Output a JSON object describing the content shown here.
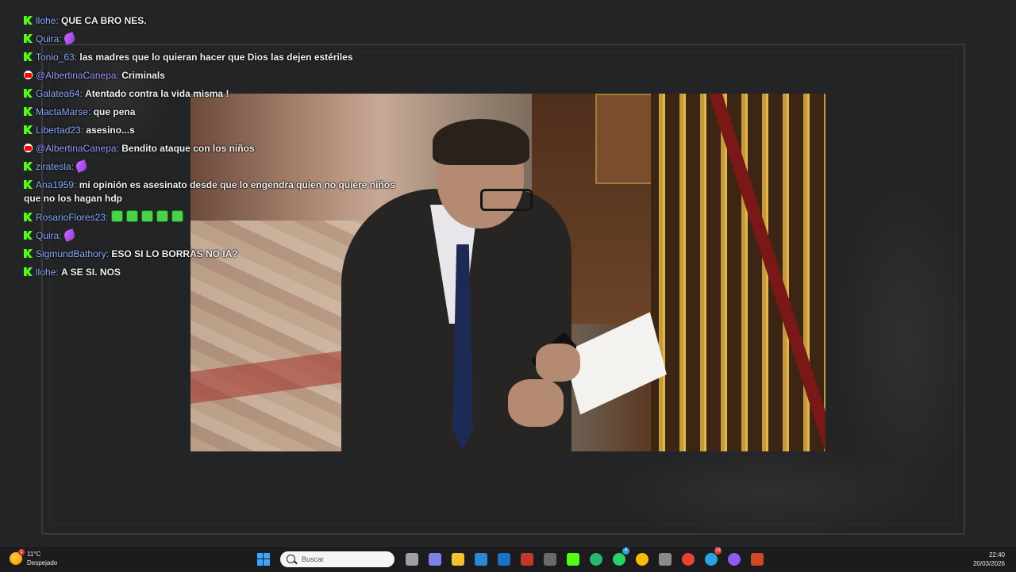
{
  "chat": {
    "messages": [
      {
        "platform": "kick",
        "user": "llohe",
        "text": "QUE CA BRO NES.",
        "emotes": []
      },
      {
        "platform": "kick",
        "user": "Quira",
        "text": "",
        "emotes": [
          "feather"
        ]
      },
      {
        "platform": "kick",
        "user": "Tonio_63",
        "text": "las madres que lo quieran hacer que Dios las dejen estériles",
        "emotes": []
      },
      {
        "platform": "youtube",
        "user": "@AlbertinaCanepa",
        "text": "Criminals",
        "emotes": []
      },
      {
        "platform": "kick",
        "user": "Galatea64",
        "text": "Atentado contra la vida misma !",
        "emotes": []
      },
      {
        "platform": "kick",
        "user": "MactaMarse",
        "text": "que pena",
        "emotes": []
      },
      {
        "platform": "kick",
        "user": "Libertad23",
        "text": "asesino...s",
        "emotes": []
      },
      {
        "platform": "youtube",
        "user": "@AlbertinaCanepa",
        "text": "Bendito ataque con los niños",
        "emotes": []
      },
      {
        "platform": "kick",
        "user": "ziratesla",
        "text": "",
        "emotes": [
          "feather"
        ]
      },
      {
        "platform": "kick",
        "user": "Ana1959",
        "text": "mi opinión es asesinato desde que lo engendra quien no quiere niños que no los hagan hdp",
        "emotes": []
      },
      {
        "platform": "kick",
        "user": "RosarioFlores23",
        "text": "",
        "emotes": [
          "green",
          "green",
          "green",
          "green",
          "green"
        ]
      },
      {
        "platform": "kick",
        "user": "Quira",
        "text": "",
        "emotes": [
          "feather"
        ]
      },
      {
        "platform": "kick",
        "user": "SigmundBathory",
        "text": "ESO SI LO BORRAS NO IA?",
        "emotes": []
      },
      {
        "platform": "kick",
        "user": "llohe",
        "text": "A SE SI. NOS",
        "emotes": []
      }
    ]
  },
  "taskbar": {
    "weather": {
      "temp": "11°C",
      "condition": "Despejado",
      "alert": "1"
    },
    "search_placeholder": "Buscar",
    "icons": [
      {
        "name": "start",
        "color": "#3aa6ff"
      },
      {
        "name": "task-view",
        "color": "#9aa0a6"
      },
      {
        "name": "teams",
        "color": "#7b83eb"
      },
      {
        "name": "file-explorer",
        "color": "#f2c230"
      },
      {
        "name": "microsoft-store",
        "color": "#2b88d8"
      },
      {
        "name": "outlook",
        "color": "#1a73c8"
      },
      {
        "name": "obs-red",
        "color": "#c0392b"
      },
      {
        "name": "app-cube",
        "color": "#6a6a6a"
      },
      {
        "name": "kick-app",
        "color": "#53fc18"
      },
      {
        "name": "edge",
        "color": "#2bb673"
      },
      {
        "name": "whatsapp",
        "color": "#25d366",
        "badge": "4"
      },
      {
        "name": "chrome",
        "color": "#fbbc05"
      },
      {
        "name": "app-gray",
        "color": "#8a8a8a"
      },
      {
        "name": "chrome-2",
        "color": "#ea4335"
      },
      {
        "name": "telegram",
        "color": "#2aa3e1",
        "badge": "73"
      },
      {
        "name": "circle-app",
        "color": "#8a5cf6"
      },
      {
        "name": "powerpoint",
        "color": "#d24726"
      }
    ],
    "clock": {
      "time": "22:40",
      "date": "20/03/2026"
    }
  }
}
